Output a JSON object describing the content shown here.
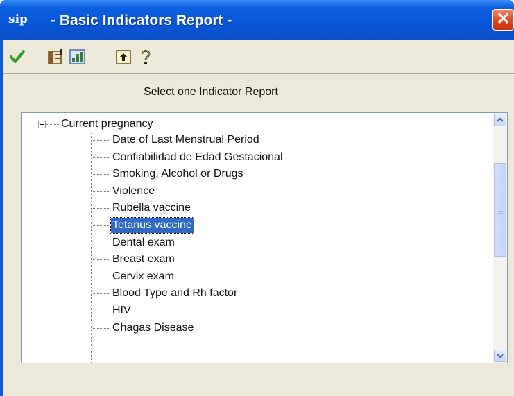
{
  "window": {
    "title": "- Basic Indicators Report -",
    "app_icon_text": "sip",
    "close_symbol": "✕"
  },
  "toolbar": {
    "buttons": [
      {
        "name": "accept-icon",
        "color": "#2e9a2e"
      },
      {
        "name": "print-preview-icon",
        "color": "#8a5a2b"
      },
      {
        "name": "chart-icon",
        "color": "#3a7a3a"
      },
      {
        "name": "export-icon",
        "color": "#b08a2a"
      },
      {
        "name": "help-icon",
        "color": "#c89a1a"
      }
    ]
  },
  "main": {
    "heading": "Select one Indicator Report"
  },
  "tree": {
    "root": {
      "label": "Current pregnancy",
      "expanded": true
    },
    "children": [
      {
        "label": "Date of Last Menstrual Period",
        "selected": false
      },
      {
        "label": "Confiabilidad de Edad Gestacional",
        "selected": false
      },
      {
        "label": "Smoking, Alcohol or Drugs",
        "selected": false
      },
      {
        "label": "Violence",
        "selected": false
      },
      {
        "label": "Rubella vaccine",
        "selected": false
      },
      {
        "label": "Tetanus vaccine",
        "selected": true
      },
      {
        "label": "Dental exam",
        "selected": false
      },
      {
        "label": "Breast exam",
        "selected": false
      },
      {
        "label": "Cervix exam",
        "selected": false
      },
      {
        "label": "Blood Type and Rh factor",
        "selected": false
      },
      {
        "label": "HIV",
        "selected": false
      },
      {
        "label": "Chagas Disease",
        "selected": false
      }
    ]
  },
  "colors": {
    "titlebar": "#0756d8",
    "selection": "#316ac5",
    "face": "#ece9d8"
  }
}
